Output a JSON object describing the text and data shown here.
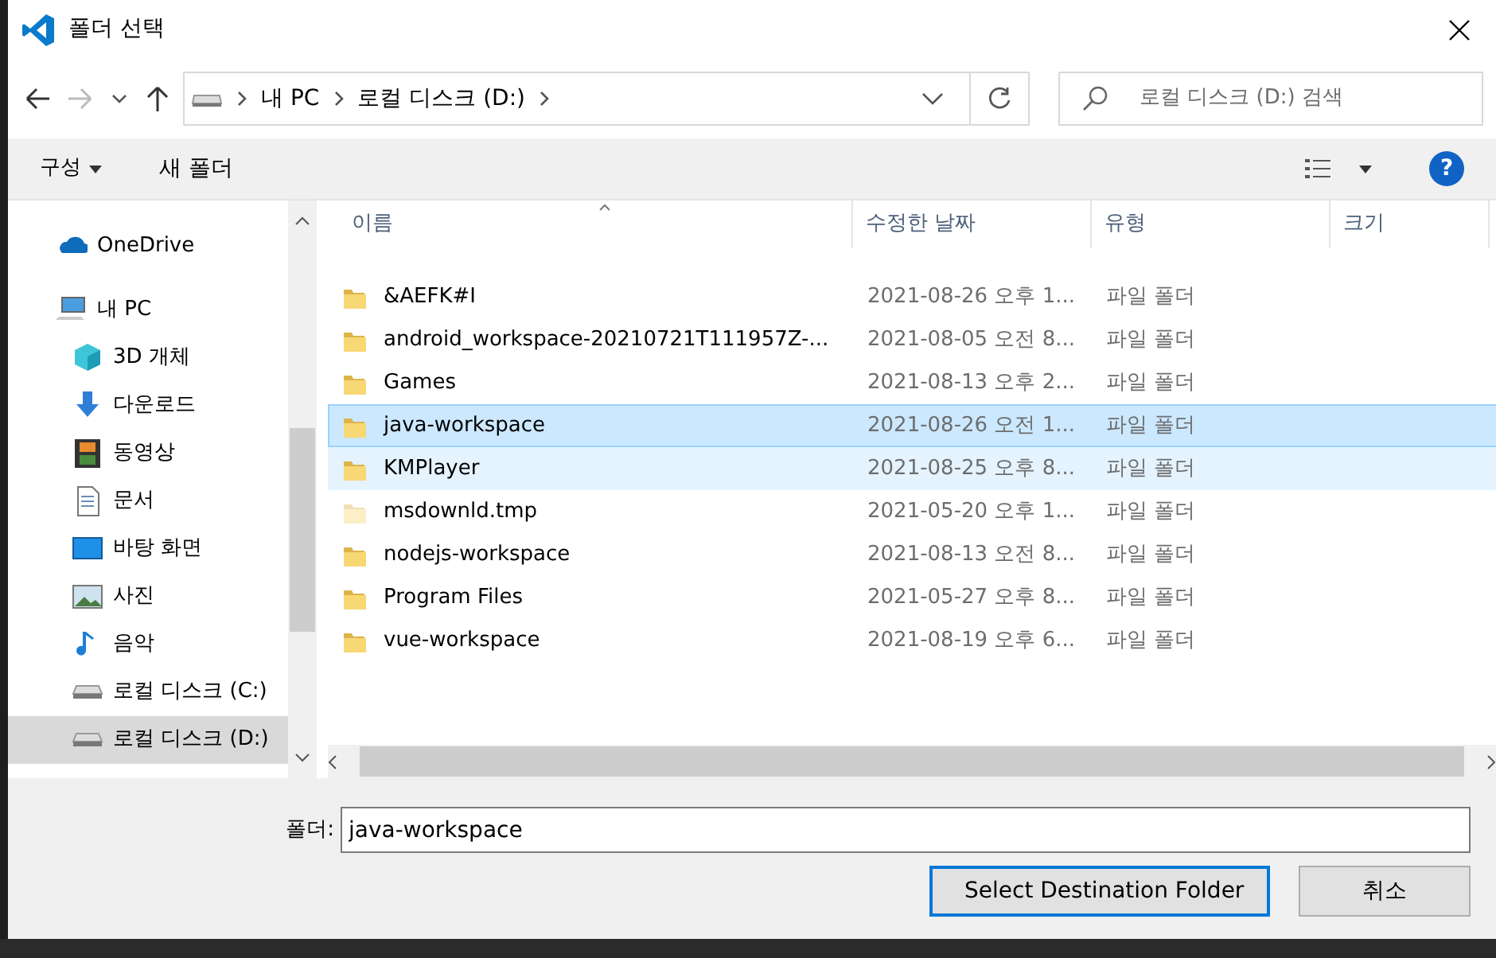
{
  "window": {
    "title": "폴더 선택"
  },
  "address_bar": {
    "crumbs": [
      "내 PC",
      "로컬 디스크 (D:)"
    ]
  },
  "search": {
    "placeholder": "로컬 디스크 (D:) 검색"
  },
  "toolbar": {
    "organize": "구성",
    "new_folder": "새 폴더",
    "help": "?"
  },
  "sidebar": {
    "items": [
      {
        "label": "OneDrive",
        "selected": false
      },
      {
        "label": "내 PC",
        "selected": false,
        "children": [
          {
            "label": "3D 개체",
            "selected": false
          },
          {
            "label": "다운로드",
            "selected": false
          },
          {
            "label": "동영상",
            "selected": false
          },
          {
            "label": "문서",
            "selected": false
          },
          {
            "label": "바탕 화면",
            "selected": false
          },
          {
            "label": "사진",
            "selected": false
          },
          {
            "label": "음악",
            "selected": false
          },
          {
            "label": "로컬 디스크 (C:)",
            "selected": false
          },
          {
            "label": "로컬 디스크 (D:)",
            "selected": true
          }
        ]
      }
    ]
  },
  "table": {
    "columns": [
      "이름",
      "수정한 날짜",
      "유형",
      "크기"
    ],
    "rows": [
      {
        "name": "&AEFK#I",
        "date": "2021-08-26 오후 1...",
        "type": "파일 폴더",
        "selected": false,
        "hover": false,
        "faded": false
      },
      {
        "name": "android_workspace-20210721T111957Z-...",
        "date": "2021-08-05 오전 8...",
        "type": "파일 폴더",
        "selected": false,
        "hover": false,
        "faded": false
      },
      {
        "name": "Games",
        "date": "2021-08-13 오후 2...",
        "type": "파일 폴더",
        "selected": false,
        "hover": false,
        "faded": false
      },
      {
        "name": "java-workspace",
        "date": "2021-08-26 오전 1...",
        "type": "파일 폴더",
        "selected": true,
        "hover": false,
        "faded": false
      },
      {
        "name": "KMPlayer",
        "date": "2021-08-25 오후 8...",
        "type": "파일 폴더",
        "selected": false,
        "hover": true,
        "faded": false
      },
      {
        "name": "msdownld.tmp",
        "date": "2021-05-20 오후 1...",
        "type": "파일 폴더",
        "selected": false,
        "hover": false,
        "faded": true
      },
      {
        "name": "nodejs-workspace",
        "date": "2021-08-13 오전 8...",
        "type": "파일 폴더",
        "selected": false,
        "hover": false,
        "faded": false
      },
      {
        "name": "Program Files",
        "date": "2021-05-27 오후 8...",
        "type": "파일 폴더",
        "selected": false,
        "hover": false,
        "faded": false
      },
      {
        "name": "vue-workspace",
        "date": "2021-08-19 오후 6...",
        "type": "파일 폴더",
        "selected": false,
        "hover": false,
        "faded": false
      }
    ]
  },
  "folder_field": {
    "label": "폴더:",
    "value": "java-workspace"
  },
  "buttons": [
    {
      "label": "Select Destination Folder",
      "default": true
    },
    {
      "label": "취소",
      "default": false
    }
  ]
}
